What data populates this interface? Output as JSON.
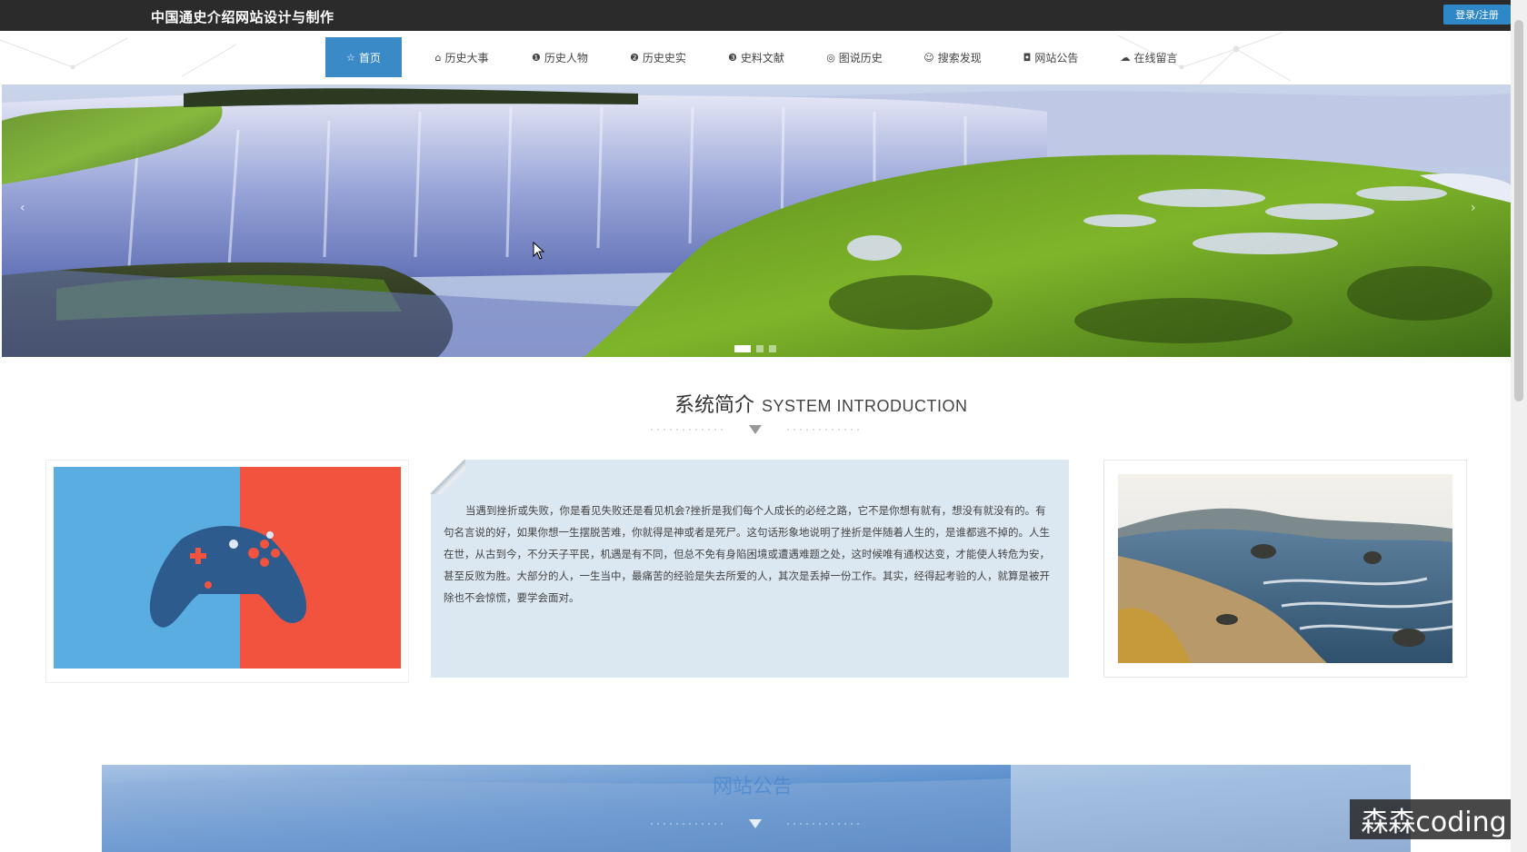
{
  "header": {
    "site_title": "中国通史介绍网站设计与制作",
    "login_label": "登录/注册"
  },
  "nav": {
    "items": [
      {
        "label": "首页",
        "icon": "star-icon",
        "glyph": "☆"
      },
      {
        "label": "历史大事",
        "icon": "lock-icon",
        "glyph": "⌂"
      },
      {
        "label": "历史人物",
        "icon": "info-icon",
        "glyph": "❶"
      },
      {
        "label": "历史史实",
        "icon": "help-icon",
        "glyph": "❷"
      },
      {
        "label": "史料文献",
        "icon": "info-icon",
        "glyph": "❸"
      },
      {
        "label": "图说历史",
        "icon": "globe-icon",
        "glyph": "◎"
      },
      {
        "label": "搜索发现",
        "icon": "smile-icon",
        "glyph": "☺"
      },
      {
        "label": "网站公告",
        "icon": "camera-icon",
        "glyph": "◘"
      },
      {
        "label": "在线留言",
        "icon": "cloud-icon",
        "glyph": "☁"
      }
    ]
  },
  "banner": {
    "prev_arrow": "‹",
    "next_arrow": "›",
    "slide_count": 3,
    "active_slide": 1
  },
  "intro": {
    "title_cn": "系统简介",
    "title_en": "SYSTEM INTRODUCTION",
    "text": "当遇到挫折或失败，你是看见失败还是看见机会?挫折是我们每个人成长的必经之路，它不是你想有就有，想没有就没有的。有句名言说的好，如果你想一生摆脱苦难，你就得是神或者是死尸。这句话形象地说明了挫折是伴随着人生的，是谁都逃不掉的。人生在世，从古到今，不分天子平民，机遇是有不同，但总不免有身陷困境或遭遇难题之处，这时候唯有通权达变，才能使人转危为安，甚至反败为胜。大部分的人，一生当中，最痛苦的经验是失去所爱的人，其次是丢掉一份工作。其实，经得起考验的人，就算是被开除也不会惊慌，要学会面对。"
  },
  "announcement": {
    "title": "网站公告"
  },
  "watermark": "森森coding"
}
